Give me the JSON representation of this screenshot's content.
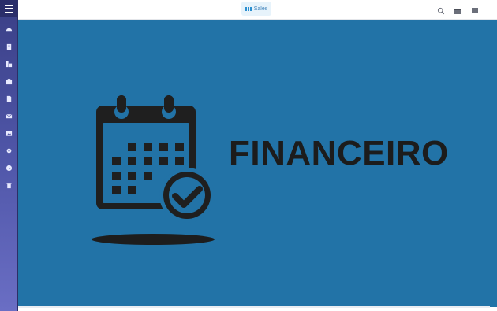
{
  "topbar": {
    "app_button_label": "Sales",
    "icons": [
      "search-icon",
      "calendar-icon",
      "chat-icon"
    ]
  },
  "sidebar": {
    "items": [
      {
        "icon": "dashboard-icon"
      },
      {
        "icon": "contacts-icon"
      },
      {
        "icon": "reports-icon"
      },
      {
        "icon": "briefcase-icon"
      },
      {
        "icon": "document-icon"
      },
      {
        "icon": "mail-icon"
      },
      {
        "icon": "image-icon"
      },
      {
        "icon": "settings-icon"
      },
      {
        "icon": "clock-icon"
      },
      {
        "icon": "trash-icon"
      }
    ]
  },
  "banner": {
    "title": "FINANCEIRO",
    "background": "#2273a7",
    "illustration": "calendar-check-icon"
  }
}
